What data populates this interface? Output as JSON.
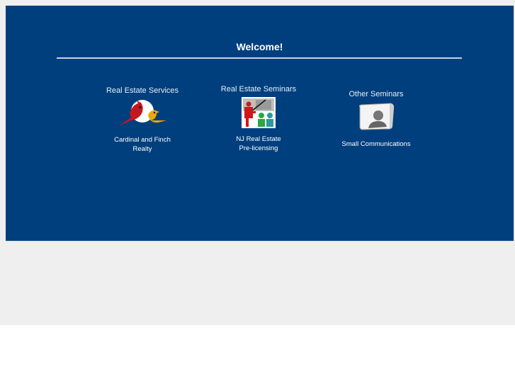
{
  "page": {
    "welcome": "Welcome!"
  },
  "columns": [
    {
      "heading": "Real Estate Services",
      "icon": "cardinal-finch-icon",
      "caption_line1": "Cardinal and Finch",
      "caption_line2": "Realty"
    },
    {
      "heading": "Real Estate Seminars",
      "icon": "presentation-icon",
      "caption_line1": "NJ Real Estate",
      "caption_line2": "Pre-licensing"
    },
    {
      "heading": "Other Seminars",
      "icon": "profile-card-icon",
      "caption_line1": "Small Communications",
      "caption_line2": ""
    }
  ],
  "colors": {
    "panel": "#003f7e",
    "background": "#efefef",
    "rule": "#c9d3de"
  }
}
